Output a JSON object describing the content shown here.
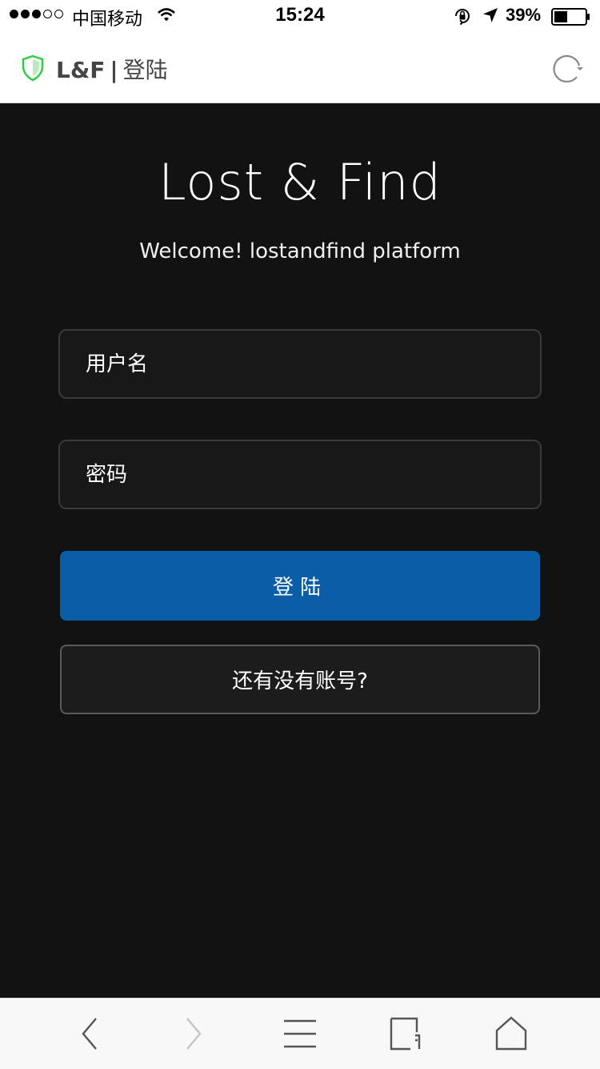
{
  "status_bar": {
    "carrier": "中国移动",
    "time": "15:24",
    "battery": "39%",
    "signal_strength": 3,
    "signal_max": 5,
    "icons": [
      "wifi-icon",
      "orientation-lock-icon",
      "location-arrow-icon",
      "battery-icon"
    ]
  },
  "header": {
    "brand": "L&F",
    "separator": "|",
    "page": "登陆",
    "icons": [
      "shield-icon",
      "reload-icon"
    ],
    "shield_color": "#2ecc40"
  },
  "main": {
    "title": "Lost & Find",
    "subtitle": "Welcome! lostandfind platform",
    "username_placeholder": "用户名",
    "password_placeholder": "密码",
    "login_label": "登陆",
    "register_label": "还有没有账号?",
    "background": "#121212",
    "accent": "#0a5ea8"
  },
  "toolbar": {
    "icons": [
      "back-arrow-icon",
      "forward-arrow-icon",
      "menu-icon",
      "tabs-icon",
      "home-icon"
    ]
  }
}
